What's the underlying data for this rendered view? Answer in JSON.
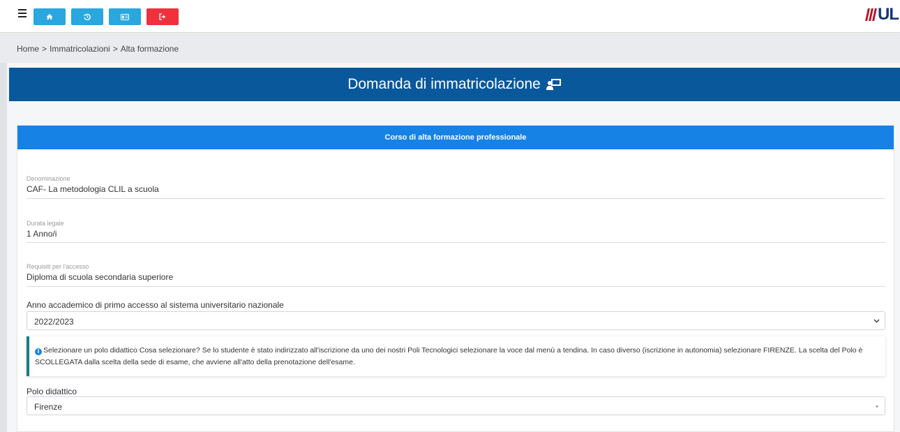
{
  "toolbar": {
    "menu_icon": "hamburger-icon",
    "buttons": [
      {
        "icon": "home-icon",
        "color": "#29a7de"
      },
      {
        "icon": "history-icon",
        "color": "#29a7de"
      },
      {
        "icon": "id-card-icon",
        "color": "#29a7de"
      },
      {
        "icon": "logout-icon",
        "color": "#f0313c"
      }
    ],
    "logo_text": "UL"
  },
  "breadcrumb": {
    "items": [
      "Home",
      "Immatricolazioni",
      "Alta formazione"
    ],
    "separator": ">"
  },
  "header": {
    "title": "Domanda di immatricolazione",
    "icon": "presentation-icon",
    "background": "#0a589c"
  },
  "card": {
    "title": "Corso di alta formazione professionale",
    "header_color": "#1682e6",
    "fields": [
      {
        "label": "Denominazione",
        "value": "CAF- La metodologia CLIL a scuola"
      },
      {
        "label": "Durata legale",
        "value": "1 Anno/i"
      },
      {
        "label": "Requisiti per l'accesso",
        "value": "Diploma di scuola secondaria superiore"
      }
    ],
    "academic_year": {
      "label": "Anno accademico di primo accesso al sistema universitario nazionale",
      "value": "2022/2023"
    },
    "info": {
      "icon": "info-icon",
      "text": "Selezionare un polo didattico Cosa selezionare? Se lo studente è stato indirizzato all'iscrizione da uno dei nostri Poli Tecnologici selezionare la voce dal menù a tendina. In caso diverso (iscrizione in autonomia) selezionare FIRENZE. La scelta del Polo è SCOLLEGATA dalla scelta della sede di esame, che avviene all'atto della prenotazione dell'esame."
    },
    "polo": {
      "label": "Polo didattico",
      "value": "Firenze"
    }
  }
}
